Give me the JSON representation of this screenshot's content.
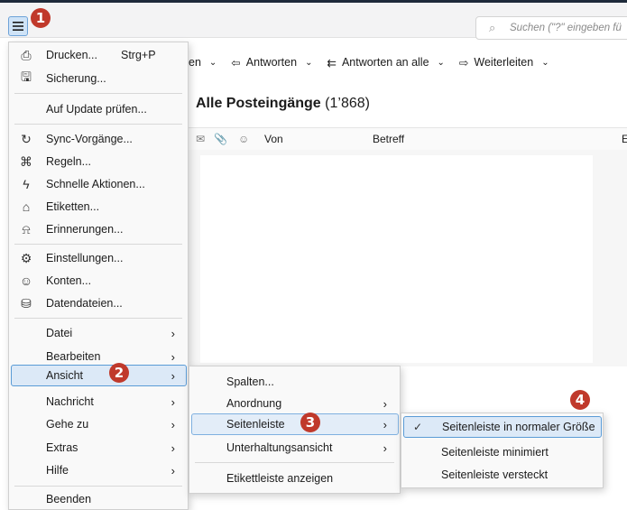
{
  "topbar": {
    "search_placeholder": "Suchen (\"?\" eingeben fü"
  },
  "badges": {
    "b1": "1",
    "b2": "2",
    "b3": "3",
    "b4": "4"
  },
  "toolbar": {
    "partial_label": "en",
    "reply": "Antworten",
    "reply_all": "Antworten an alle",
    "forward": "Weiterleiten"
  },
  "folder": {
    "title": "Alle Posteingänge",
    "count": "(1’868)"
  },
  "columns": {
    "from": "Von",
    "subject": "Betreff",
    "extra": "E"
  },
  "main_menu": {
    "print": "Drucken...",
    "print_shortcut": "Strg+P",
    "backup": "Sicherung...",
    "check_update": "Auf Update prüfen...",
    "sync": "Sync-Vorgänge...",
    "rules": "Regeln...",
    "quick_actions": "Schnelle Aktionen...",
    "labels": "Etiketten...",
    "reminders": "Erinnerungen...",
    "settings": "Einstellungen...",
    "accounts": "Konten...",
    "data_files": "Datendateien...",
    "file": "Datei",
    "edit": "Bearbeiten",
    "view": "Ansicht",
    "message": "Nachricht",
    "goto": "Gehe zu",
    "extras": "Extras",
    "help": "Hilfe",
    "quit": "Beenden"
  },
  "view_menu": {
    "columns": "Spalten...",
    "arrangement": "Anordnung",
    "sidebar": "Seitenleiste",
    "conversation_view": "Unterhaltungsansicht",
    "show_labelbar": "Etikettleiste anzeigen"
  },
  "sidebar_menu": {
    "normal": "Seitenleiste in normaler Größe",
    "minimized": "Seitenleiste minimiert",
    "hidden": "Seitenleiste versteckt"
  },
  "colors": {
    "accent": "#5a9bd6",
    "badge": "#c0392b",
    "highlight": "#dce9f7"
  }
}
